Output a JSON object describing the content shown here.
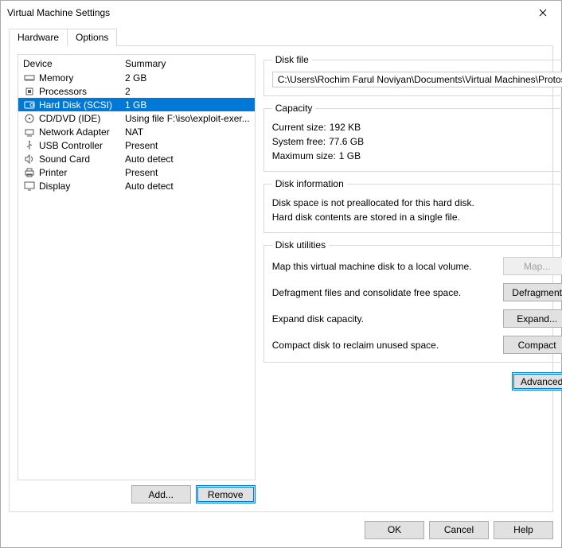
{
  "window": {
    "title": "Virtual Machine Settings"
  },
  "tabs": {
    "hardware": "Hardware",
    "options": "Options"
  },
  "device_header": {
    "device": "Device",
    "summary": "Summary"
  },
  "devices": [
    {
      "name": "Memory",
      "summary": "2 GB",
      "icon": "memory-icon",
      "selected": false
    },
    {
      "name": "Processors",
      "summary": "2",
      "icon": "cpu-icon",
      "selected": false
    },
    {
      "name": "Hard Disk (SCSI)",
      "summary": "1 GB",
      "icon": "disk-icon",
      "selected": true
    },
    {
      "name": "CD/DVD (IDE)",
      "summary": "Using file F:\\iso\\exploit-exer...",
      "icon": "cd-icon",
      "selected": false
    },
    {
      "name": "Network Adapter",
      "summary": "NAT",
      "icon": "network-icon",
      "selected": false
    },
    {
      "name": "USB Controller",
      "summary": "Present",
      "icon": "usb-icon",
      "selected": false
    },
    {
      "name": "Sound Card",
      "summary": "Auto detect",
      "icon": "sound-icon",
      "selected": false
    },
    {
      "name": "Printer",
      "summary": "Present",
      "icon": "printer-icon",
      "selected": false
    },
    {
      "name": "Display",
      "summary": "Auto detect",
      "icon": "display-icon",
      "selected": false
    }
  ],
  "left_buttons": {
    "add": "Add...",
    "remove": "Remove"
  },
  "disk_file": {
    "legend": "Disk file",
    "path": "C:\\Users\\Rochim Farul Noviyan\\Documents\\Virtual Machines\\Protos"
  },
  "capacity": {
    "legend": "Capacity",
    "current_label": "Current size:",
    "current_value": "192 KB",
    "free_label": "System free:",
    "free_value": "77.6 GB",
    "max_label": "Maximum size:",
    "max_value": "1 GB"
  },
  "disk_info": {
    "legend": "Disk information",
    "line1": "Disk space is not preallocated for this hard disk.",
    "line2": "Hard disk contents are stored in a single file."
  },
  "utilities": {
    "legend": "Disk utilities",
    "map_label": "Map this virtual machine disk to a local volume.",
    "map_btn": "Map...",
    "defrag_label": "Defragment files and consolidate free space.",
    "defrag_btn": "Defragment",
    "expand_label": "Expand disk capacity.",
    "expand_btn": "Expand...",
    "compact_label": "Compact disk to reclaim unused space.",
    "compact_btn": "Compact"
  },
  "advanced_btn": "Advanced...",
  "footer": {
    "ok": "OK",
    "cancel": "Cancel",
    "help": "Help"
  }
}
